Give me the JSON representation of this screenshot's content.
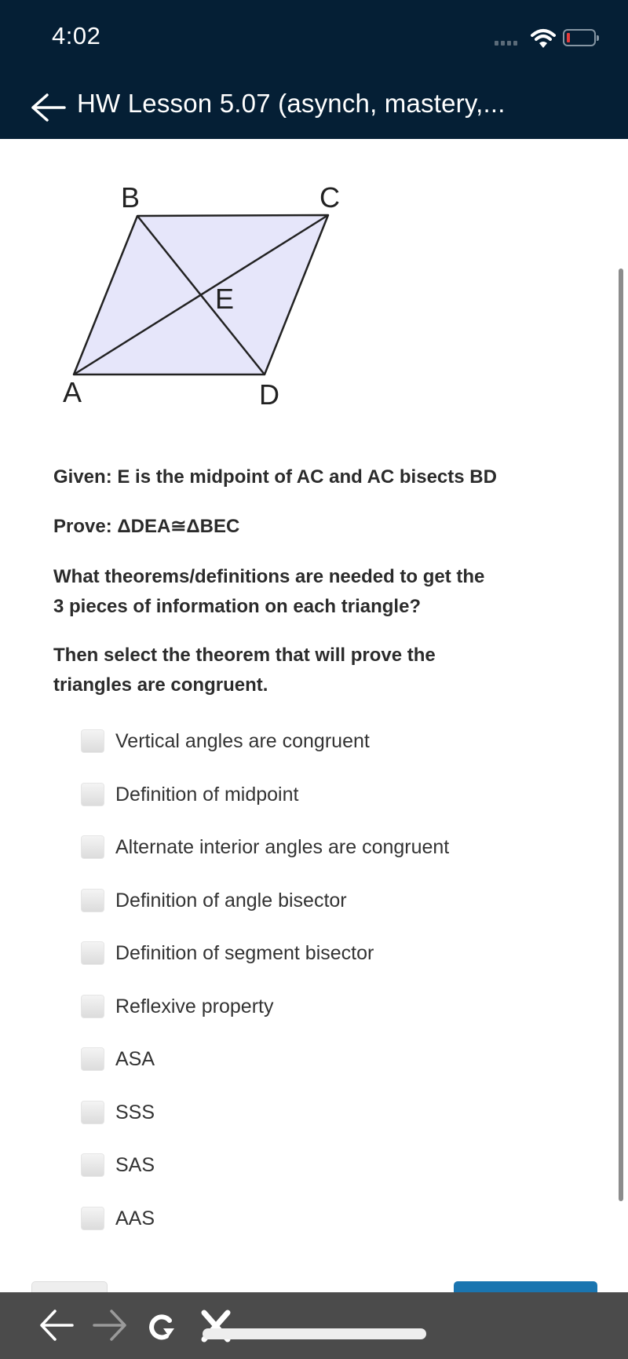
{
  "status_bar": {
    "time": "4:02",
    "icons": [
      "signal-dots-icon",
      "wifi-icon",
      "battery-low-icon"
    ],
    "battery_color": "#e53b3b"
  },
  "header": {
    "title": "HW Lesson 5.07 (asynch, mastery,...",
    "back_icon": "arrow-left-icon",
    "background": "#051f35"
  },
  "diagram": {
    "fill": "#e6e6fa",
    "labels": {
      "A": "A",
      "B": "B",
      "C": "C",
      "D": "D",
      "E": "E"
    }
  },
  "question": {
    "given": "Given: E is the midpoint of AC and AC bisects BD",
    "prove": "Prove: ΔDEA≅ΔBEC",
    "prompt_1_line1": "What theorems/definitions are needed to get the",
    "prompt_1_line2": "3 pieces of information on each triangle?",
    "prompt_2_line1": "Then select the theorem that will prove the",
    "prompt_2_line2": "triangles are congruent."
  },
  "options": [
    {
      "label": "Vertical angles are congruent",
      "checked": false
    },
    {
      "label": "Definition of midpoint",
      "checked": false
    },
    {
      "label": "Alternate interior angles are congruent",
      "checked": false
    },
    {
      "label": "Definition of angle bisector",
      "checked": false
    },
    {
      "label": "Definition of segment bisector",
      "checked": false
    },
    {
      "label": "Reflexive property",
      "checked": false
    },
    {
      "label": "ASA",
      "checked": false
    },
    {
      "label": "SSS",
      "checked": false
    },
    {
      "label": "SAS",
      "checked": false
    },
    {
      "label": "AAS",
      "checked": false
    }
  ],
  "footer_buttons": {
    "primary_color": "#1a75b0"
  },
  "browser_toolbar": {
    "icons": [
      "back-arrow-icon",
      "forward-arrow-icon",
      "reload-icon",
      "close-icon"
    ]
  }
}
